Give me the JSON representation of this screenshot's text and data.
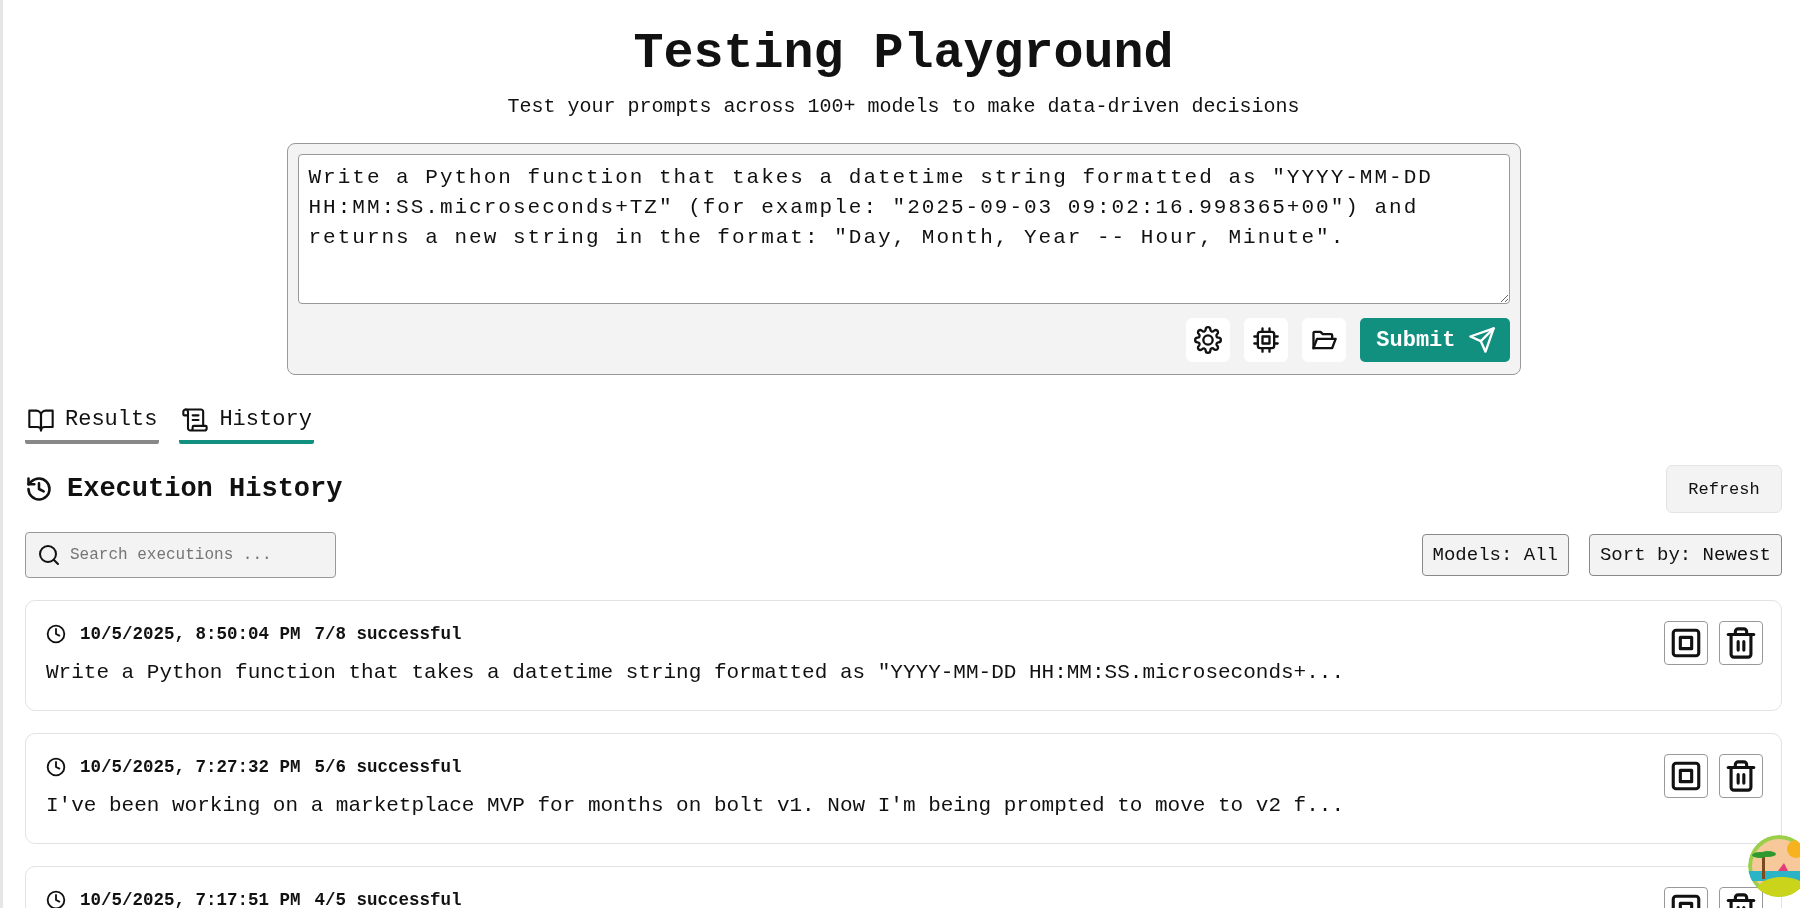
{
  "header": {
    "title": "Testing Playground",
    "subtitle": "Test your prompts across 100+ models to make data-driven decisions"
  },
  "prompt": {
    "value": "Write a Python function that takes a datetime string formatted as \"YYYY-MM-DD HH:MM:SS.microseconds+TZ\" (for example: \"2025-09-03 09:02:16.998365+00\") and returns a new string in the format: \"Day, Month, Year -- Hour, Minute\".",
    "tools": [
      {
        "kind": "settings"
      },
      {
        "kind": "chip"
      },
      {
        "kind": "folder"
      }
    ],
    "submit": "Submit"
  },
  "tabs": [
    {
      "label": "Results",
      "kind": "book",
      "selected": false
    },
    {
      "label": "History",
      "kind": "scroll",
      "selected": true
    }
  ],
  "history": {
    "title": "Execution History",
    "refresh": "Refresh",
    "search": {
      "placeholder": "Search executions ..."
    },
    "filters": [
      "Models: All",
      "Sort by: Newest"
    ],
    "executions": [
      {
        "time": "10/5/2025, 8:50:04 PM",
        "result": "7/8 successful",
        "prompt": "Write a Python function that takes a datetime string formatted as \"YYYY-MM-DD HH:MM:SS.microseconds+..."
      },
      {
        "time": "10/5/2025, 7:27:32 PM",
        "result": "5/6 successful",
        "prompt": "I've been working on a marketplace MVP for months on bolt v1. Now I'm being prompted to move to v2 f..."
      },
      {
        "time": "10/5/2025, 7:17:51 PM",
        "result": "4/5 successful"
      }
    ]
  }
}
